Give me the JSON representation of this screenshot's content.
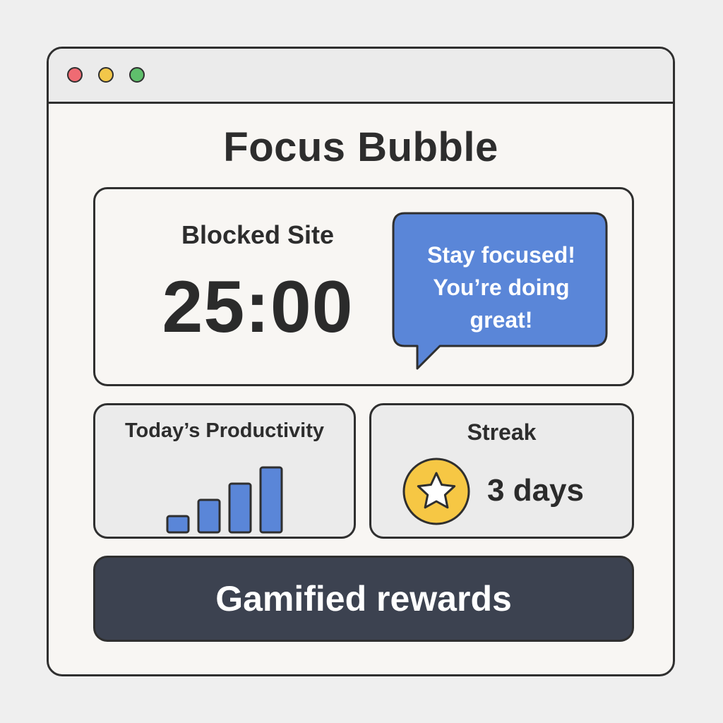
{
  "window": {
    "controls": [
      "close",
      "minimize",
      "maximize"
    ]
  },
  "app": {
    "title": "Focus Bubble"
  },
  "timer": {
    "label": "Blocked Site",
    "value": "25:00"
  },
  "bubble": {
    "line1": "Stay focused!",
    "line2": "You’re doing",
    "line3": "great!"
  },
  "productivity": {
    "label": "Today’s Productivity",
    "levels": [
      1,
      2,
      3,
      4
    ]
  },
  "streak": {
    "label": "Streak",
    "value": "3 days",
    "icon": "star-icon"
  },
  "rewards": {
    "label": "Gamified rewards"
  },
  "colors": {
    "close": "#ef6b73",
    "minimize": "#f2c74a",
    "maximize": "#5fbf6c",
    "accent_blue": "#5a86d8",
    "star_yellow": "#f6c744",
    "button_dark": "#3c4250",
    "outline": "#2f2f2f"
  }
}
